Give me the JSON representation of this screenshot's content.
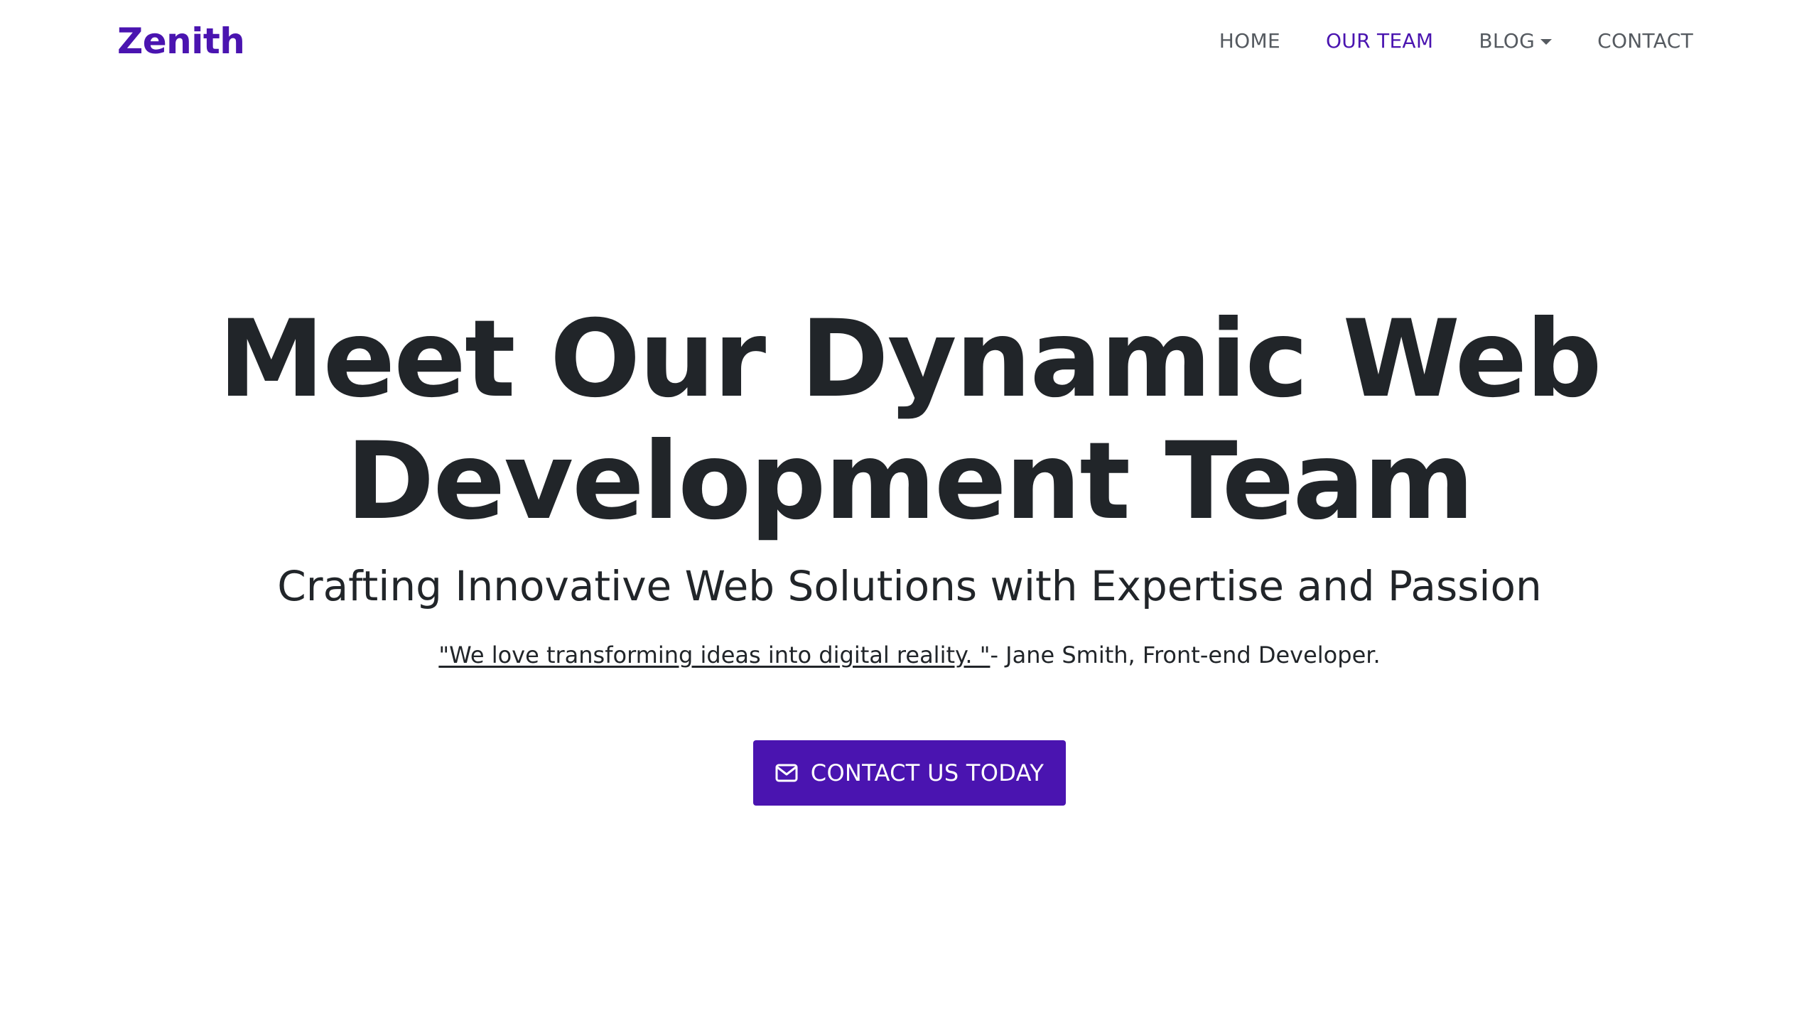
{
  "brand": {
    "name": "Zenith"
  },
  "nav": {
    "items": [
      {
        "label": "HOME"
      },
      {
        "label": "OUR TEAM"
      },
      {
        "label": "BLOG"
      },
      {
        "label": "CONTACT"
      }
    ]
  },
  "hero": {
    "title": "Meet Our Dynamic Web Development Team",
    "subtitle": "Crafting Innovative Web Solutions with Expertise and Passion",
    "quote": "\"We love transforming ideas into digital reality. \"",
    "attribution": "- Jane Smith, Front-end Developer.",
    "cta_label": "CONTACT US TODAY",
    "cta_icon": "envelope-icon"
  },
  "colors": {
    "accent": "#4a14b0",
    "text": "#212529",
    "nav_text": "#555a60",
    "background": "#ffffff"
  }
}
